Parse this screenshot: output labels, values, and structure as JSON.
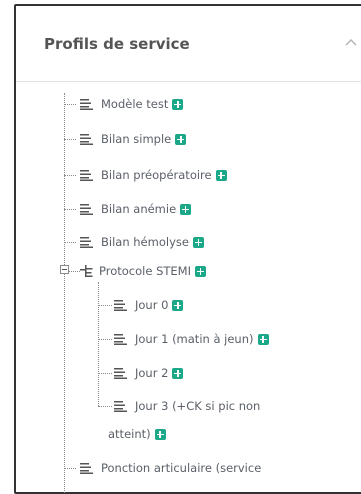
{
  "panel": {
    "title": "Profils de service"
  },
  "tree": {
    "items": [
      {
        "label": "Modèle test"
      },
      {
        "label": "Bilan simple"
      },
      {
        "label": "Bilan préopératoire"
      },
      {
        "label": "Bilan anémie"
      },
      {
        "label": "Bilan hémolyse"
      },
      {
        "label": "Protocole STEMI",
        "children": [
          {
            "label": "Jour 0"
          },
          {
            "label": "Jour 1 (matin à jeun)"
          },
          {
            "label": "Jour 2"
          },
          {
            "label_line1": "Jour 3 (+CK si pic non",
            "label_line2": "atteint)"
          }
        ]
      },
      {
        "label": "Ponction articulaire (service"
      }
    ]
  },
  "colors": {
    "accent_add": "#1aa889",
    "text": "#5b6068",
    "title": "#555555"
  },
  "icons": {
    "item": "document-lines-icon",
    "folder": "tree-branch-icon",
    "add": "plus-square-icon",
    "collapse": "chevron-up-icon",
    "expanded": "minus-box-icon"
  }
}
